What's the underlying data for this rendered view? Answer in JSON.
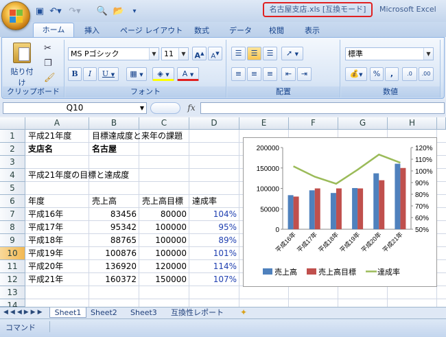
{
  "window": {
    "title": "名古屋支店.xls  [互換モード]",
    "app_name": "Microsoft Excel"
  },
  "ribbon_tabs": [
    "ホーム",
    "挿入",
    "ページ レイアウト",
    "数式",
    "データ",
    "校閲",
    "表示"
  ],
  "ribbon": {
    "clipboard": {
      "label": "クリップボード",
      "paste": "貼り付け"
    },
    "font": {
      "label": "フォント",
      "name": "MS Pゴシック",
      "size": "11"
    },
    "alignment": {
      "label": "配置"
    },
    "number": {
      "label": "数値",
      "format": "標準"
    }
  },
  "formula_bar": {
    "name_box": "Q10",
    "fx": "fx",
    "content": ""
  },
  "columns": [
    "A",
    "B",
    "C",
    "D",
    "E",
    "F",
    "G",
    "H"
  ],
  "rows": [
    "1",
    "2",
    "3",
    "4",
    "5",
    "6",
    "7",
    "8",
    "9",
    "10",
    "11",
    "12",
    "13",
    "14"
  ],
  "selected_row": "10",
  "cells": {
    "a1": "平成21年度",
    "b1": "目標達成度と来年の課題",
    "a2": "支店名",
    "b2": "名古屋",
    "a4": "平成21年度の目標と達成度",
    "a6": "年度",
    "b6": "売上高",
    "c6": "売上高目標",
    "d6": "達成率",
    "table": [
      {
        "year": "平成16年",
        "sales": "83456",
        "target": "80000",
        "rate": "104%"
      },
      {
        "year": "平成17年",
        "sales": "95342",
        "target": "100000",
        "rate": "95%"
      },
      {
        "year": "平成18年",
        "sales": "88765",
        "target": "100000",
        "rate": "89%"
      },
      {
        "year": "平成19年",
        "sales": "100876",
        "target": "100000",
        "rate": "101%"
      },
      {
        "year": "平成20年",
        "sales": "136920",
        "target": "120000",
        "rate": "114%"
      },
      {
        "year": "平成21年",
        "sales": "160372",
        "target": "150000",
        "rate": "107%"
      }
    ]
  },
  "chart_data": {
    "type": "bar",
    "categories": [
      "平成16年",
      "平成17年",
      "平成18年",
      "平成19年",
      "平成20年",
      "平成21年"
    ],
    "series": [
      {
        "name": "売上高",
        "type": "bar",
        "axis": "left",
        "color": "#4f81bd",
        "values": [
          83456,
          95342,
          88765,
          100876,
          136920,
          160372
        ]
      },
      {
        "name": "売上高目標",
        "type": "bar",
        "axis": "left",
        "color": "#c0504d",
        "values": [
          80000,
          100000,
          100000,
          100000,
          120000,
          150000
        ]
      },
      {
        "name": "達成率",
        "type": "line",
        "axis": "right",
        "color": "#9bbb59",
        "values": [
          104,
          95,
          89,
          101,
          114,
          107
        ]
      }
    ],
    "y_left": {
      "min": 0,
      "max": 200000,
      "step": 50000,
      "ticks": [
        "0",
        "50000",
        "100000",
        "150000",
        "200000"
      ]
    },
    "y_right": {
      "min": 50,
      "max": 120,
      "step": 10,
      "ticks": [
        "50%",
        "60%",
        "70%",
        "80%",
        "90%",
        "100%",
        "110%",
        "120%"
      ]
    },
    "legend": "bottom",
    "grid": false
  },
  "sheet_tabs": [
    "Sheet1",
    "Sheet2",
    "Sheet3",
    "互換性レポート"
  ],
  "active_sheet": "Sheet1",
  "status": {
    "mode": "コマンド"
  }
}
